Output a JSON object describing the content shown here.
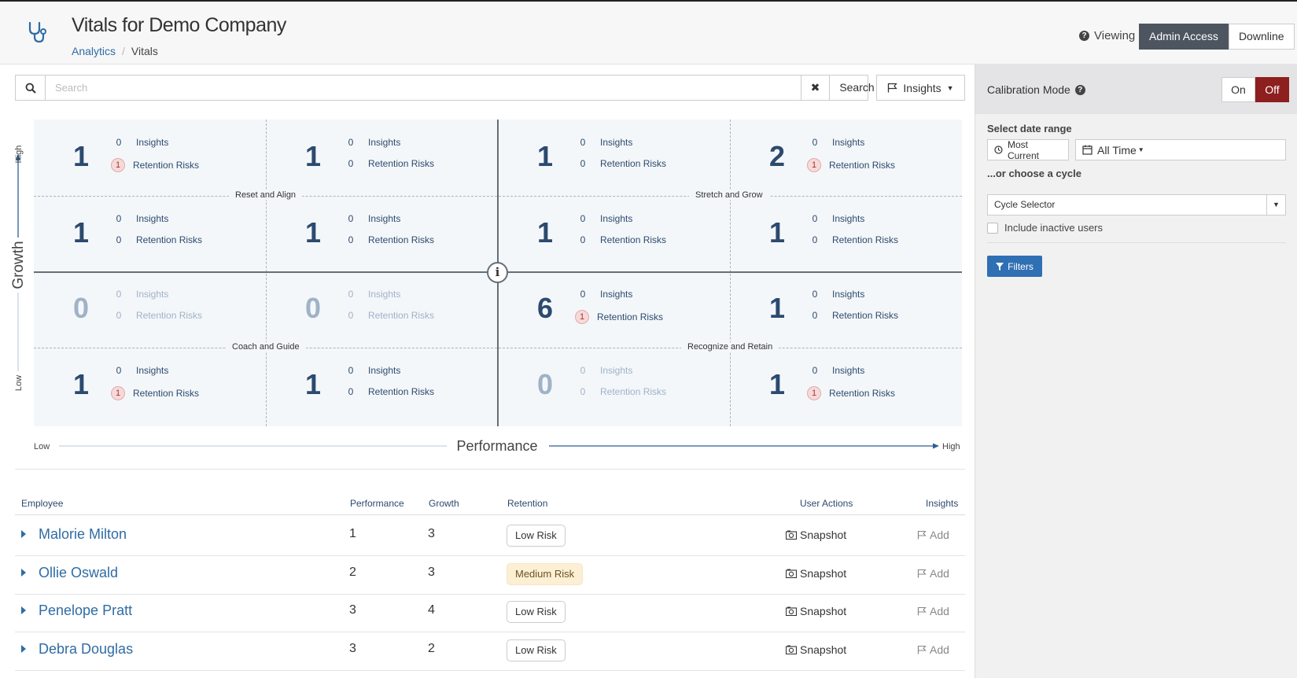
{
  "header": {
    "title": "Vitals for Demo Company",
    "breadcrumb": [
      "Analytics",
      "Vitals"
    ],
    "viewing_label": "Viewing",
    "view_options": [
      "Admin Access",
      "Downline"
    ],
    "active_view": "Admin Access"
  },
  "search": {
    "placeholder": "Search",
    "button_label": "Search",
    "insights_label": "Insights"
  },
  "grid": {
    "insights_label": "Insights",
    "retention_label": "Retention Risks",
    "quadrants": [
      "Reset and Align",
      "Stretch and Grow",
      "Coach and Guide",
      "Recognize and Retain"
    ],
    "cells": [
      {
        "count": "1",
        "insights": "0",
        "risks": "1",
        "risk_badge": true
      },
      {
        "count": "1",
        "insights": "0",
        "risks": "0",
        "risk_badge": false
      },
      {
        "count": "1",
        "insights": "0",
        "risks": "0",
        "risk_badge": false
      },
      {
        "count": "2",
        "insights": "0",
        "risks": "1",
        "risk_badge": true
      },
      {
        "count": "1",
        "insights": "0",
        "risks": "0",
        "risk_badge": false
      },
      {
        "count": "1",
        "insights": "0",
        "risks": "0",
        "risk_badge": false
      },
      {
        "count": "1",
        "insights": "0",
        "risks": "0",
        "risk_badge": false
      },
      {
        "count": "1",
        "insights": "0",
        "risks": "0",
        "risk_badge": false
      },
      {
        "count": "0",
        "insights": "0",
        "risks": "0",
        "risk_badge": false,
        "dim": true
      },
      {
        "count": "0",
        "insights": "0",
        "risks": "0",
        "risk_badge": false,
        "dim": true
      },
      {
        "count": "6",
        "insights": "0",
        "risks": "1",
        "risk_badge": true
      },
      {
        "count": "1",
        "insights": "0",
        "risks": "0",
        "risk_badge": false
      },
      {
        "count": "1",
        "insights": "0",
        "risks": "1",
        "risk_badge": true
      },
      {
        "count": "1",
        "insights": "0",
        "risks": "0",
        "risk_badge": false
      },
      {
        "count": "0",
        "insights": "0",
        "risks": "0",
        "risk_badge": false,
        "dim": true
      },
      {
        "count": "1",
        "insights": "0",
        "risks": "1",
        "risk_badge": true
      }
    ],
    "growth_axis": {
      "label": "Growth",
      "high": "High",
      "low": "Low"
    },
    "performance_axis": {
      "label": "Performance",
      "low": "Low",
      "high": "High"
    }
  },
  "table": {
    "headers": {
      "employee": "Employee",
      "performance": "Performance",
      "growth": "Growth",
      "retention": "Retention",
      "user_actions": "User Actions",
      "insights": "Insights"
    },
    "snapshot_label": "Snapshot",
    "add_label": "Add",
    "rows": [
      {
        "name": "Malorie Milton",
        "performance": "1",
        "growth": "3",
        "retention": "Low Risk",
        "risk_level": "low"
      },
      {
        "name": "Ollie Oswald",
        "performance": "2",
        "growth": "3",
        "retention": "Medium Risk",
        "risk_level": "medium"
      },
      {
        "name": "Penelope Pratt",
        "performance": "3",
        "growth": "4",
        "retention": "Low Risk",
        "risk_level": "low"
      },
      {
        "name": "Debra Douglas",
        "performance": "3",
        "growth": "2",
        "retention": "Low Risk",
        "risk_level": "low"
      }
    ]
  },
  "sidebar": {
    "calibration_label": "Calibration Mode",
    "calibration_options": [
      "On",
      "Off"
    ],
    "calibration_active": "Off",
    "date_range_label": "Select date range",
    "most_current_label": "Most Current",
    "all_time_label": "All Time",
    "cycle_label": "...or choose a cycle",
    "cycle_selector": "Cycle Selector",
    "include_inactive_label": "Include inactive users",
    "filters_label": "Filters"
  },
  "colors": {
    "accent_blue": "#2f6ca3",
    "off_red": "#8e1f1f",
    "admin_dark": "#4d5560",
    "filters_blue": "#2f6fb3"
  }
}
